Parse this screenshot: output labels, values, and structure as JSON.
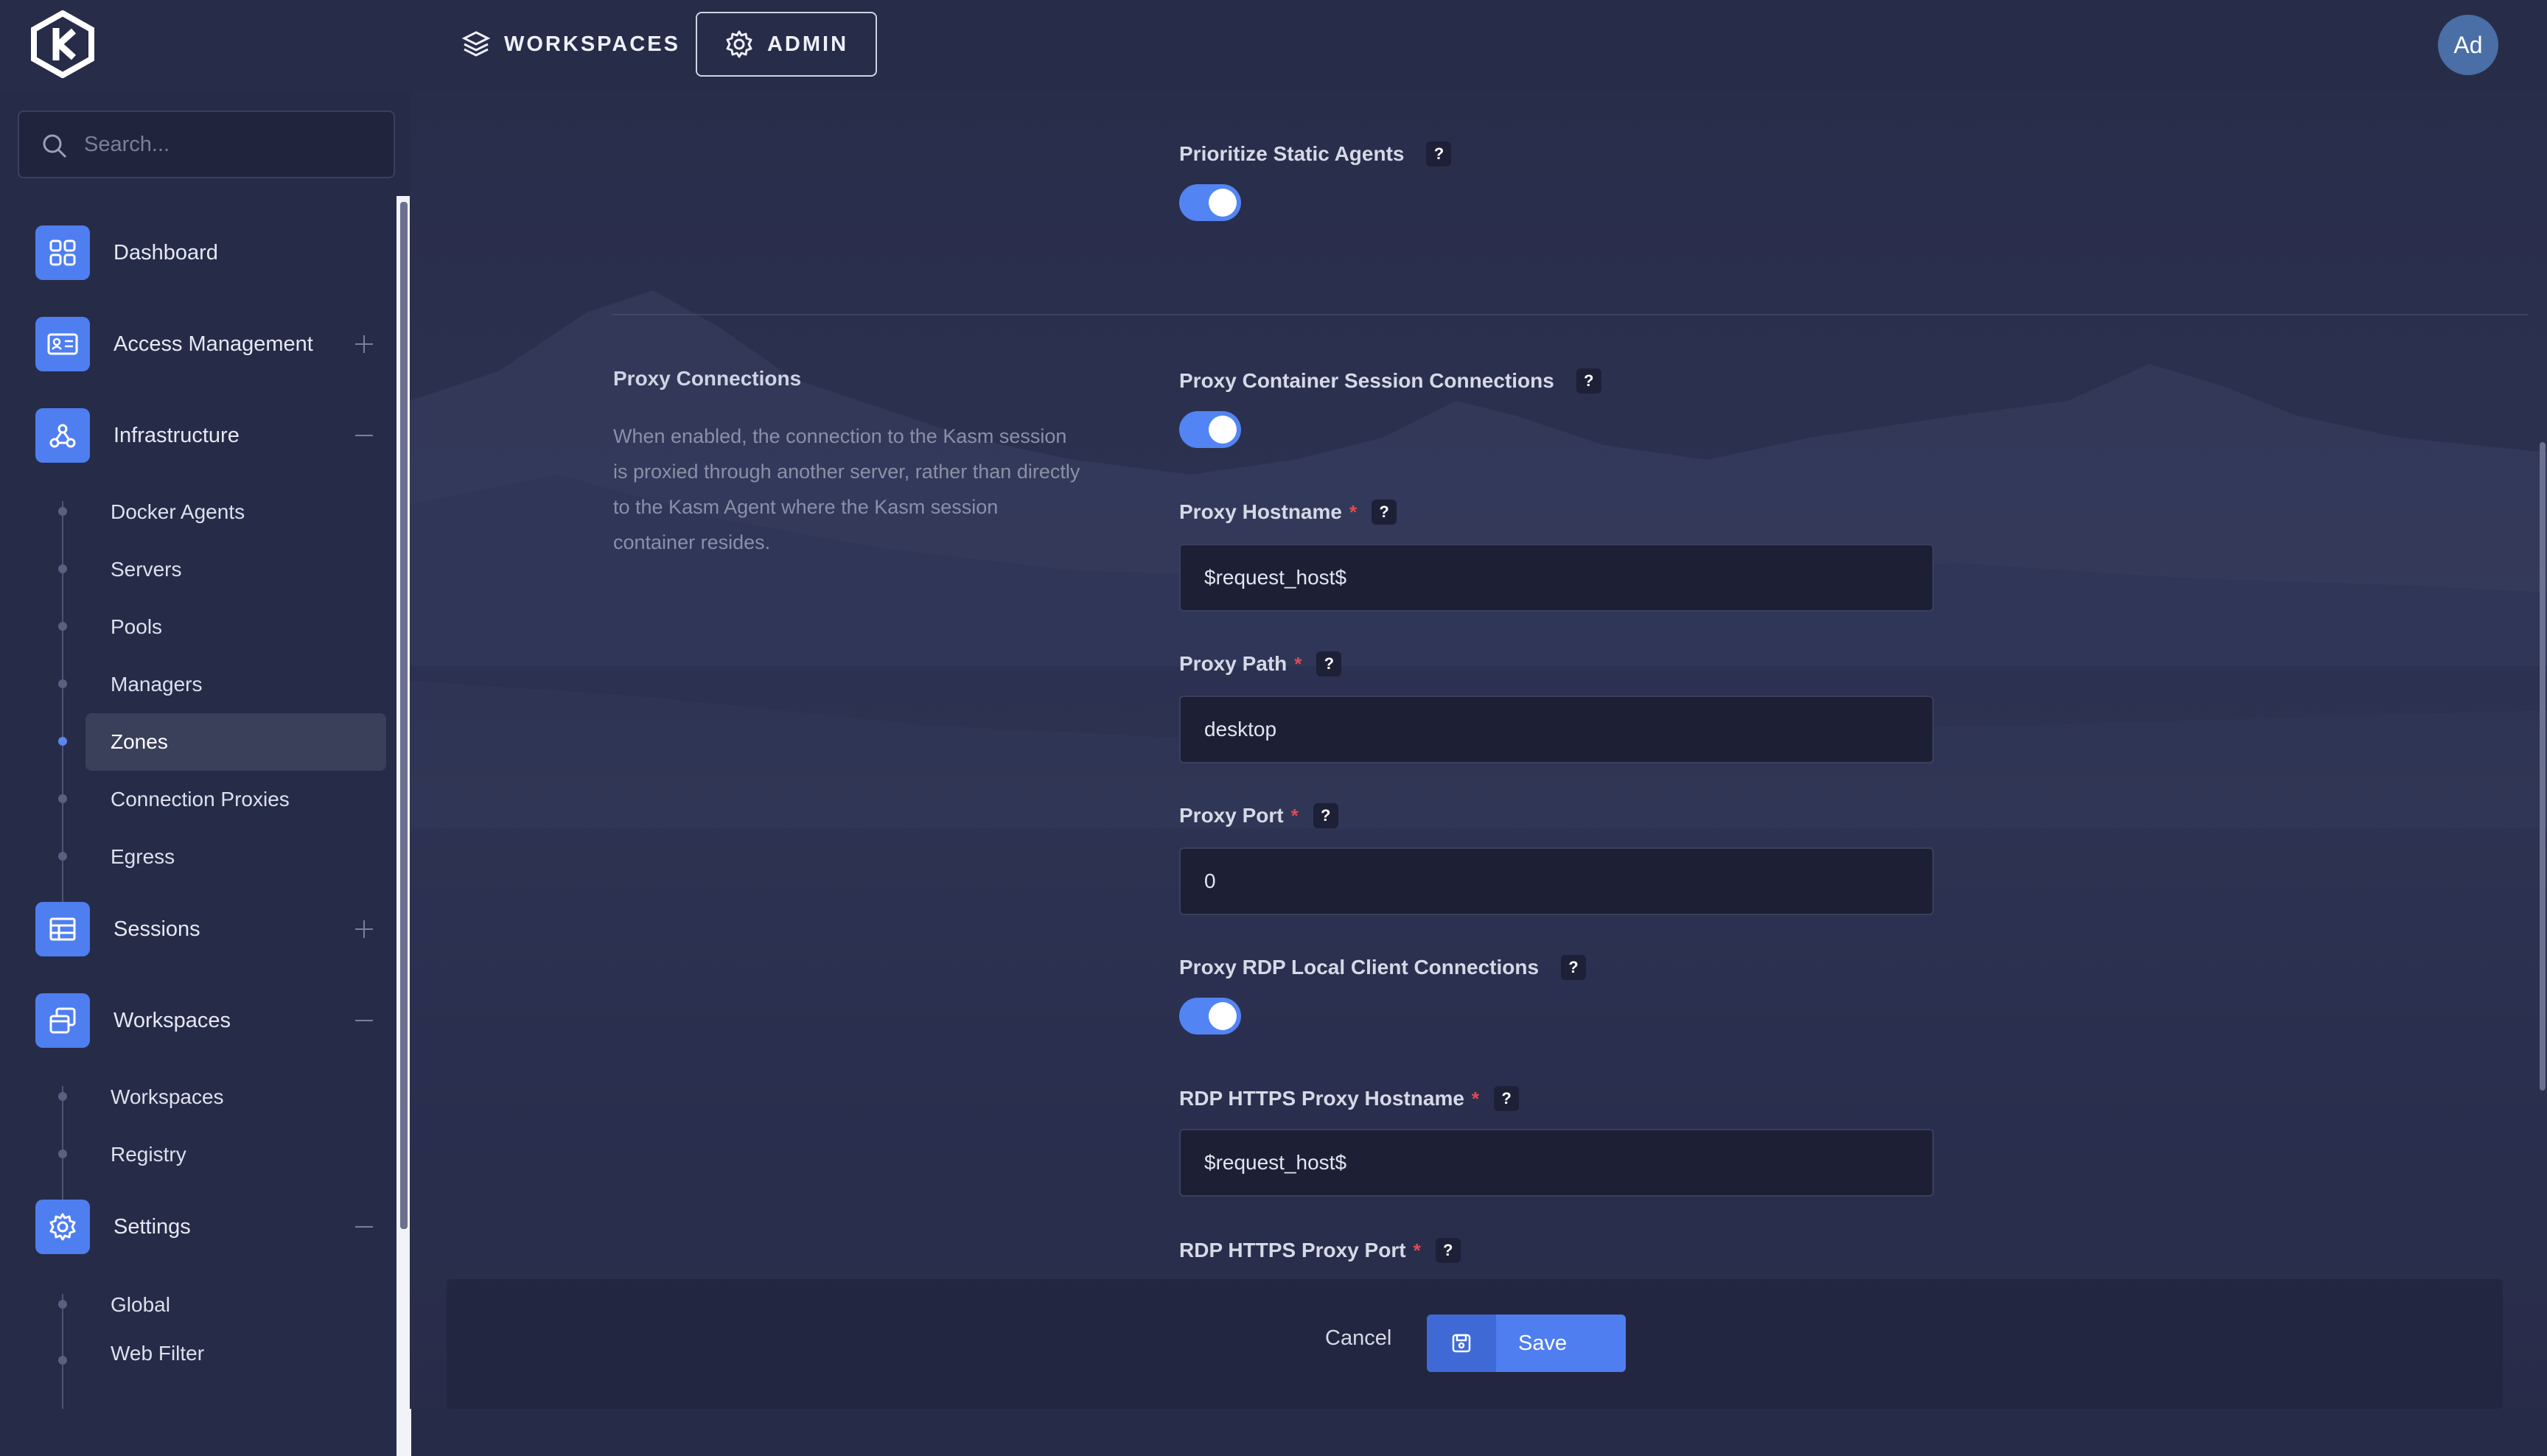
{
  "topbar": {
    "nav_workspaces": "WORKSPACES",
    "nav_admin": "ADMIN",
    "avatar_initials": "Ad"
  },
  "search": {
    "placeholder": "Search..."
  },
  "sidebar": {
    "items": [
      {
        "label": "Dashboard",
        "icon": "dashboard-grid-icon",
        "toggle": "none"
      },
      {
        "label": "Access Management",
        "icon": "id-card-icon",
        "toggle": "plus"
      },
      {
        "label": "Infrastructure",
        "icon": "network-hub-icon",
        "toggle": "minus"
      },
      {
        "label": "Sessions",
        "icon": "table-icon",
        "toggle": "plus"
      },
      {
        "label": "Workspaces",
        "icon": "stacked-windows-icon",
        "toggle": "minus"
      },
      {
        "label": "Settings",
        "icon": "gear-icon",
        "toggle": "minus"
      }
    ],
    "infrastructure_sub": [
      "Docker Agents",
      "Servers",
      "Pools",
      "Managers",
      "Zones",
      "Connection Proxies",
      "Egress"
    ],
    "workspaces_sub": [
      "Workspaces",
      "Registry"
    ],
    "settings_sub": [
      "Global",
      "Web Filter"
    ],
    "active_sub": "Zones"
  },
  "form": {
    "prioritize_static_agents": {
      "label": "Prioritize Static Agents",
      "enabled": true
    },
    "proxy_section": {
      "title": "Proxy Connections",
      "description": "When enabled, the connection to the Kasm session is proxied through another server, rather than directly to the Kasm Agent where the Kasm session container resides."
    },
    "proxy_container_session": {
      "label": "Proxy Container Session Connections",
      "enabled": true
    },
    "proxy_hostname": {
      "label": "Proxy Hostname",
      "value": "$request_host$"
    },
    "proxy_path": {
      "label": "Proxy Path",
      "value": "desktop"
    },
    "proxy_port": {
      "label": "Proxy Port",
      "value": "0"
    },
    "proxy_rdp_local": {
      "label": "Proxy RDP Local Client Connections",
      "enabled": true
    },
    "rdp_https_proxy_hostname": {
      "label": "RDP HTTPS Proxy Hostname",
      "value": "$request_host$"
    },
    "rdp_https_proxy_port": {
      "label": "RDP HTTPS Proxy Port"
    },
    "required_mark": "*",
    "help_mark": "?"
  },
  "footer": {
    "cancel": "Cancel",
    "save": "Save"
  },
  "colors": {
    "accent": "#4f7ef0",
    "background": "#262b47",
    "required": "#e14b55"
  }
}
